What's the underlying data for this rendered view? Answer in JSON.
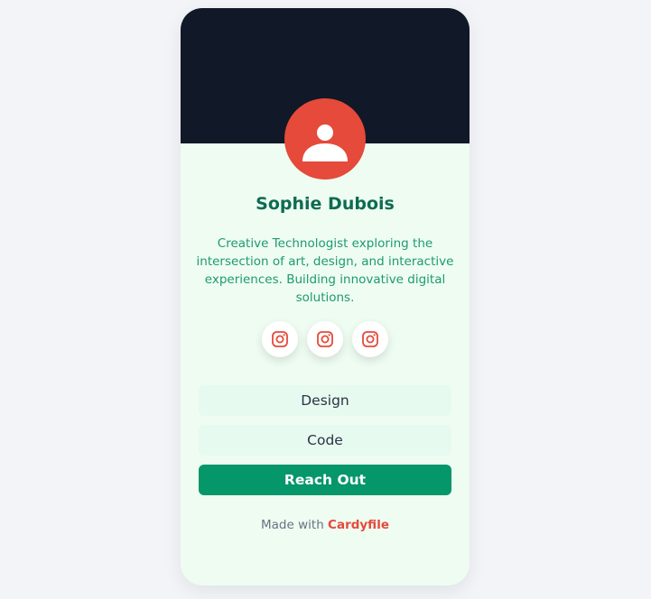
{
  "profile": {
    "name": "Sophie Dubois",
    "bio": "Creative Technologist exploring the intersection of art, design, and interactive experiences. Building innovative digital solutions."
  },
  "socials": [
    {
      "icon": "instagram-icon"
    },
    {
      "icon": "instagram-icon"
    },
    {
      "icon": "instagram-icon"
    }
  ],
  "links": [
    {
      "label": "Design"
    },
    {
      "label": "Code"
    },
    {
      "label": "Reach Out"
    }
  ],
  "footer": {
    "prefix": "Made with",
    "brand": "Cardyfile"
  },
  "colors": {
    "banner": "#111827",
    "accent": "#e54a3a",
    "primary": "#059669",
    "card": "#eefcf2"
  }
}
